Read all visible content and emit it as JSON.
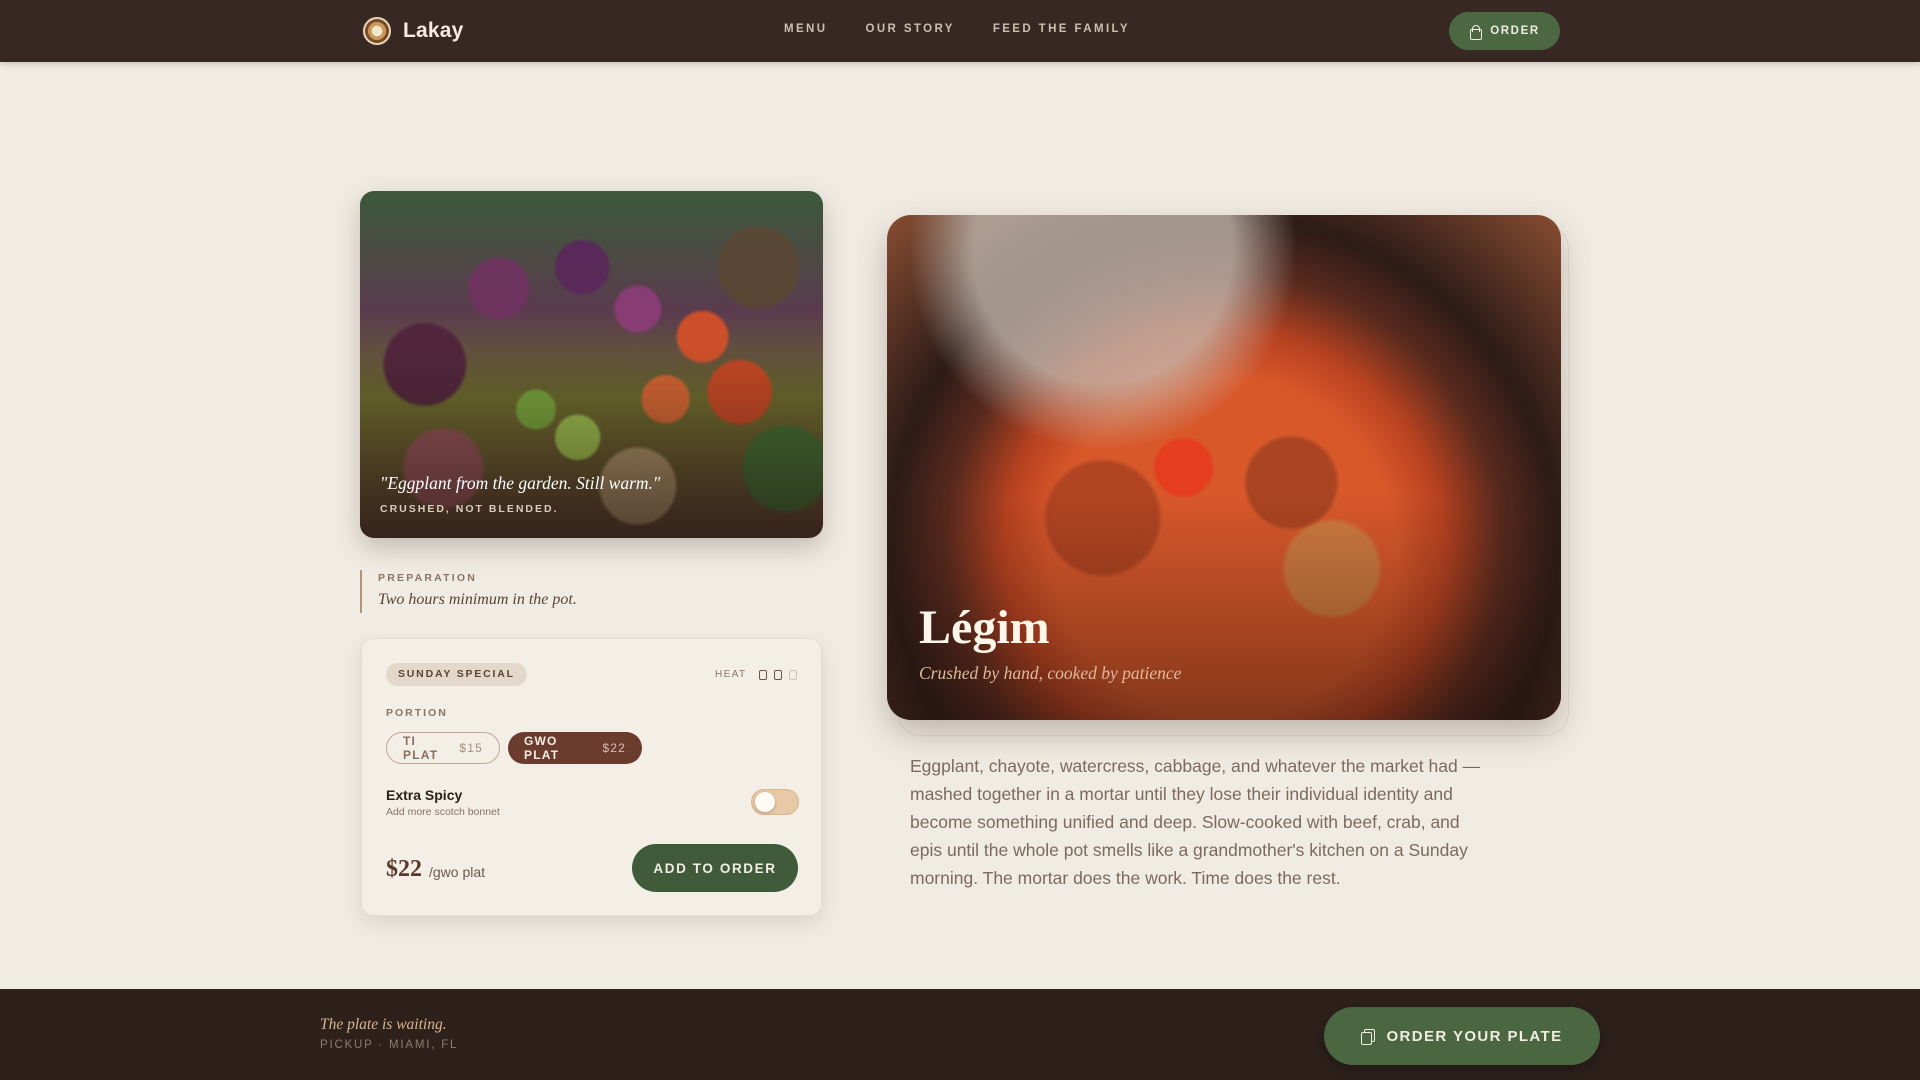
{
  "brand": {
    "name": "Lakay",
    "logo_icon": "swirl-logo-icon"
  },
  "nav": {
    "items": [
      "MENU",
      "OUR STORY",
      "FEED THE FAMILY"
    ]
  },
  "header": {
    "order_label": "ORDER",
    "order_icon": "shopping-bag-icon"
  },
  "hero_left": {
    "quote": "\"Eggplant from the garden. Still warm.\"",
    "caption": "CRUSHED, NOT BLENDED."
  },
  "preparation": {
    "label": "PREPARATION",
    "text": "Two hours minimum in the pot."
  },
  "card": {
    "badge": "SUNDAY SPECIAL",
    "heat_label": "HEAT",
    "heat_level": 2,
    "heat_max": 3,
    "portion_label": "PORTION",
    "portions": [
      {
        "name": "TI PLAT",
        "price": "$15",
        "selected": false
      },
      {
        "name": "GWO PLAT",
        "price": "$22",
        "selected": true
      }
    ],
    "extra_spicy": {
      "title": "Extra Spicy",
      "subtitle": "Add more scotch bonnet",
      "enabled": false
    },
    "price": "$22",
    "price_unit": "/gwo plat",
    "add_label": "ADD TO ORDER"
  },
  "dish": {
    "title": "Légim",
    "subtitle": "Crushed by hand, cooked by patience",
    "description": "Eggplant, chayote, watercress, cabbage, and whatever the market had — mashed together in a mortar until they lose their individual identity and become something unified and deep. Slow-cooked with beef, crab, and epis until the whole pot smells like a grandmother's kitchen on a Sunday morning. The mortar does the work. Time does the rest."
  },
  "footer": {
    "tagline": "The plate is waiting.",
    "pickup": "PICKUP · MIAMI, FL",
    "cta": "ORDER YOUR PLATE",
    "cta_icon": "copy-icon"
  },
  "colors": {
    "nav_bg": "#382823",
    "page_bg": "#f1ece3",
    "accent_green": "#4b6843",
    "accent_brown": "#6b3b2e",
    "footer_bg": "#2e211c"
  }
}
